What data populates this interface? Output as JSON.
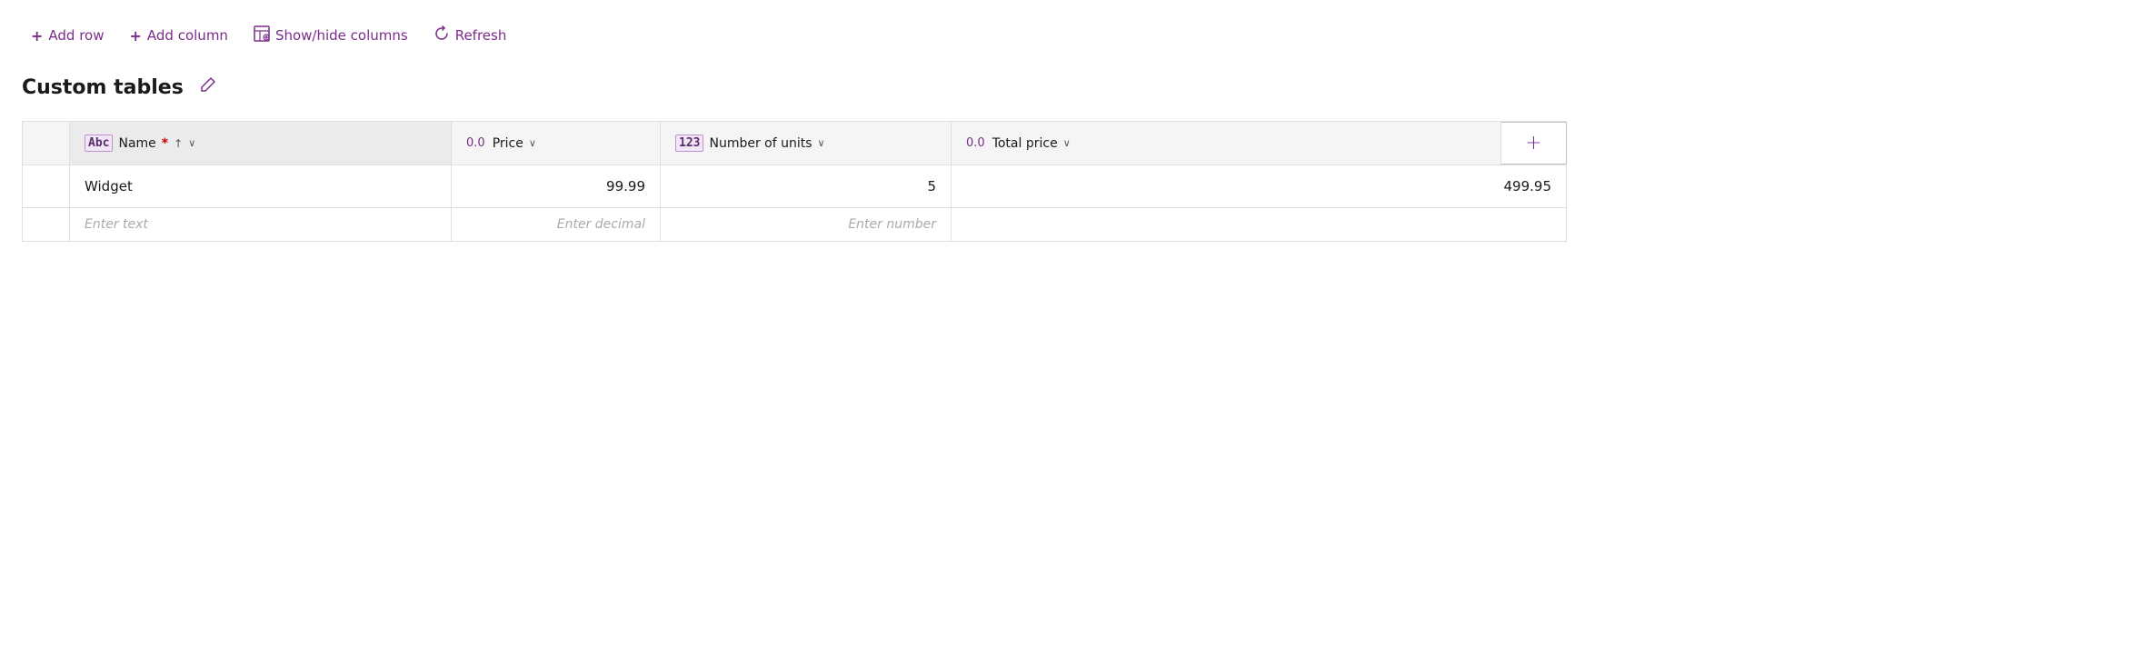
{
  "toolbar": {
    "add_row_label": "Add row",
    "add_column_label": "Add column",
    "show_hide_label": "Show/hide columns",
    "refresh_label": "Refresh"
  },
  "page": {
    "title": "Custom tables",
    "edit_icon": "✎"
  },
  "table": {
    "columns": [
      {
        "id": "name",
        "icon_type": "abc",
        "icon_label": "Abc",
        "label": "Name",
        "required": true,
        "sortable": true,
        "sort_direction": "asc",
        "has_chevron": true
      },
      {
        "id": "price",
        "icon_type": "decimal",
        "icon_label": "0.0",
        "label": "Price",
        "required": false,
        "sortable": false,
        "has_chevron": true
      },
      {
        "id": "units",
        "icon_type": "number",
        "icon_label": "123",
        "label": "Number of units",
        "required": false,
        "sortable": false,
        "has_chevron": true
      },
      {
        "id": "total",
        "icon_type": "decimal",
        "icon_label": "0.0",
        "label": "Total price",
        "required": false,
        "sortable": false,
        "has_chevron": true
      }
    ],
    "rows": [
      {
        "name": "Widget",
        "price": "99.99",
        "units": "5",
        "total": "499.95"
      }
    ],
    "input_row": {
      "name_placeholder": "Enter text",
      "price_placeholder": "Enter decimal",
      "units_placeholder": "Enter number"
    },
    "add_column_button": "+"
  }
}
